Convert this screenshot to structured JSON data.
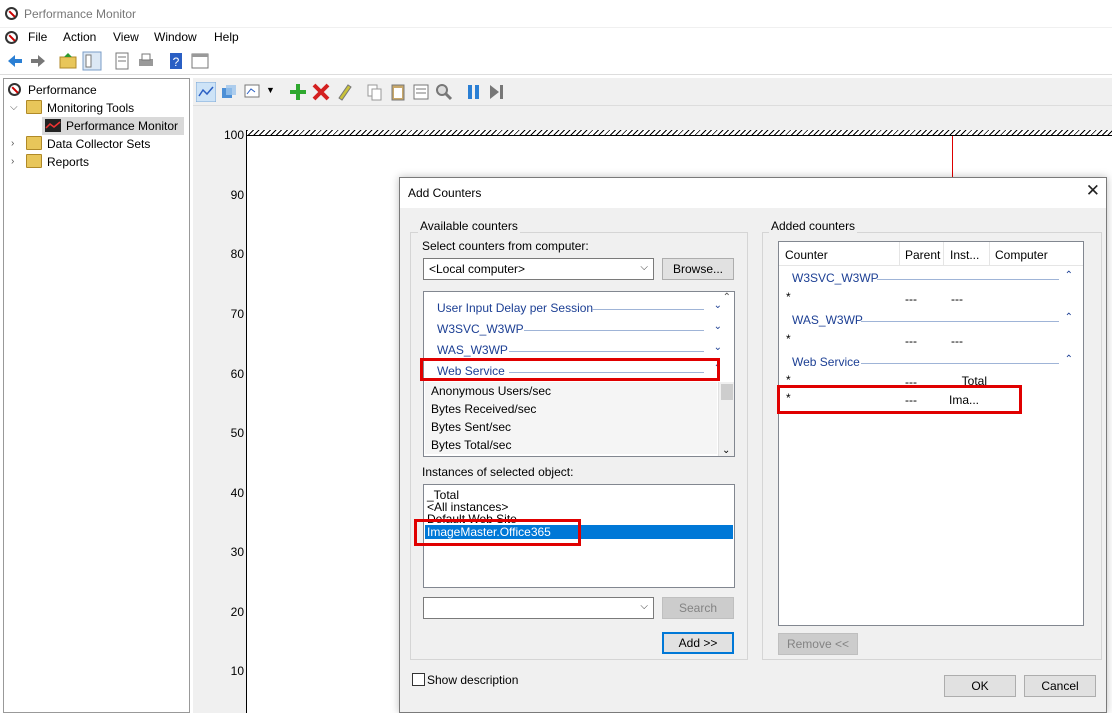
{
  "window": {
    "title": "Performance Monitor"
  },
  "menu": [
    "File",
    "Action",
    "View",
    "Window",
    "Help"
  ],
  "tree": {
    "root": "Performance",
    "items": [
      "Monitoring Tools",
      "Performance Monitor",
      "Data Collector Sets",
      "Reports"
    ]
  },
  "chart": {
    "y_ticks": [
      "100",
      "90",
      "80",
      "70",
      "60",
      "50",
      "40",
      "30",
      "20",
      "10"
    ]
  },
  "dialog": {
    "title": "Add Counters",
    "close": "✕",
    "available_label": "Available counters",
    "select_from_label": "Select counters from computer:",
    "computer_value": "<Local computer>",
    "browse_label": "Browse...",
    "objects": [
      {
        "label": "User Input Delay per Session",
        "chev": "⌄"
      },
      {
        "label": "W3SVC_W3WP",
        "chev": "⌄"
      },
      {
        "label": "WAS_W3WP",
        "chev": "⌄"
      },
      {
        "label": "Web Service",
        "chev": "⌃"
      }
    ],
    "counters": [
      "Anonymous Users/sec",
      "Bytes Received/sec",
      "Bytes Sent/sec",
      "Bytes Total/sec"
    ],
    "instances_label": "Instances of selected object:",
    "instances": [
      "_Total",
      "<All instances>",
      "Default Web Site",
      "ImageMaster.Office365"
    ],
    "search_label": "Search",
    "add_label": "Add >>",
    "added_label": "Added counters",
    "added_headers": [
      "Counter",
      "Parent",
      "Inst...",
      "Computer"
    ],
    "added_groups": [
      {
        "name": "W3SVC_W3WP",
        "rows": [
          {
            "counter": "*",
            "parent": "---",
            "inst": "---"
          }
        ]
      },
      {
        "name": "WAS_W3WP",
        "rows": [
          {
            "counter": "*",
            "parent": "---",
            "inst": "---"
          }
        ]
      },
      {
        "name": "Web Service",
        "rows": [
          {
            "counter": "*",
            "parent": "---",
            "inst": "_Total"
          },
          {
            "counter": "*",
            "parent": "---",
            "inst": "Ima..."
          }
        ]
      }
    ],
    "remove_label": "Remove <<",
    "show_description_label": "Show description",
    "ok_label": "OK",
    "cancel_label": "Cancel"
  },
  "colors": {
    "highlight": "#e00000",
    "selection": "#0078d7",
    "object_text": "#1c3f94"
  }
}
